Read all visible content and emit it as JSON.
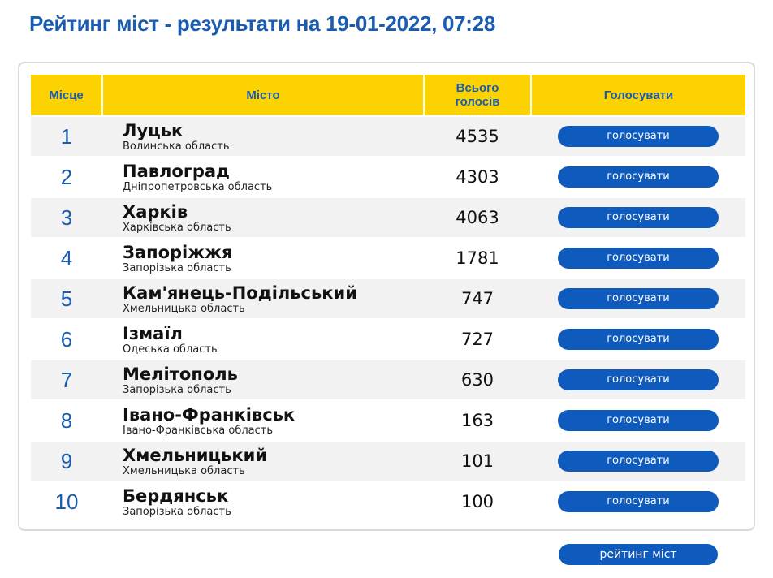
{
  "header": {
    "title": "Рейтинг міст - результати на 19-01-2022, 07:28"
  },
  "table": {
    "columns": {
      "place": "Місце",
      "city": "Місто",
      "votes_line1": "Всього",
      "votes_line2": "голосів",
      "vote": "Голосувати"
    },
    "rows": [
      {
        "place": "1",
        "city": "Луцьк",
        "region": "Волинська область",
        "votes": "4535",
        "button": "голосувати"
      },
      {
        "place": "2",
        "city": "Павлоград",
        "region": "Дніпропетровська область",
        "votes": "4303",
        "button": "голосувати"
      },
      {
        "place": "3",
        "city": "Харків",
        "region": "Харківська область",
        "votes": "4063",
        "button": "голосувати"
      },
      {
        "place": "4",
        "city": "Запоріжжя",
        "region": "Запорізька область",
        "votes": "1781",
        "button": "голосувати"
      },
      {
        "place": "5",
        "city": "Кам'янець-Подільський",
        "region": "Хмельницька область",
        "votes": "747",
        "button": "голосувати"
      },
      {
        "place": "6",
        "city": "Ізмаїл",
        "region": "Одеська область",
        "votes": "727",
        "button": "голосувати"
      },
      {
        "place": "7",
        "city": "Мелітополь",
        "region": "Запорізька область",
        "votes": "630",
        "button": "голосувати"
      },
      {
        "place": "8",
        "city": "Івано-Франківськ",
        "region": "Івано-Франківська область",
        "votes": "163",
        "button": "голосувати"
      },
      {
        "place": "9",
        "city": "Хмельницький",
        "region": "Хмельницька область",
        "votes": "101",
        "button": "голосувати"
      },
      {
        "place": "10",
        "city": "Бердянськ",
        "region": "Запорізька область",
        "votes": "100",
        "button": "голосувати"
      }
    ]
  },
  "footer": {
    "rating_button": "рейтинг міст"
  },
  "colors": {
    "accent_blue": "#1a5cb0",
    "button_blue": "#0e5bbd",
    "header_yellow": "#fcd300",
    "row_stripe": "#f2f2f2",
    "card_border": "#d7dbe0"
  }
}
